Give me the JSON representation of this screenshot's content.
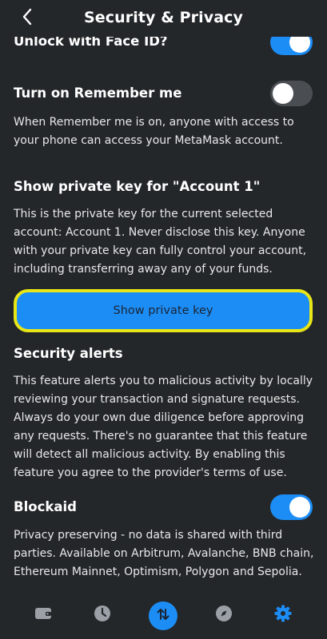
{
  "header": {
    "title": "Security & Privacy"
  },
  "face_id": {
    "label": "Unlock with Face ID?",
    "enabled": true
  },
  "remember_me": {
    "label": "Turn on Remember me",
    "enabled": false,
    "description": "When Remember me is on, anyone with access to your phone can access your MetaMask account."
  },
  "private_key": {
    "title": "Show private key for \"Account 1\"",
    "description": "This is the private key for the current selected account: Account 1. Never disclose this key. Anyone with your private key can fully control your account, including transferring away any of your funds.",
    "button_label": "Show private key"
  },
  "security_alerts": {
    "title": "Security alerts",
    "description": "This feature alerts you to malicious activity by locally reviewing your transaction and signature requests. Always do your own due diligence before approving any requests. There's no guarantee that this feature will detect all malicious activity. By enabling this feature you agree to the provider's terms of use."
  },
  "blockaid": {
    "label": "Blockaid",
    "enabled": true,
    "description": "Privacy preserving - no data is shared with third parties. Available on Arbitrum, Avalanche, BNB chain, Ethereum Mainnet, Optimism, Polygon and Sepolia."
  },
  "bottom_nav": {
    "items": [
      {
        "icon": "wallet-icon",
        "active": false
      },
      {
        "icon": "clock-icon",
        "active": false
      },
      {
        "icon": "swap-arrows-icon",
        "active": false
      },
      {
        "icon": "compass-icon",
        "active": false
      },
      {
        "icon": "gear-icon",
        "active": true
      }
    ]
  },
  "colors": {
    "background": "#24272a",
    "accent": "#1c8df5",
    "highlight_border": "#e8e617",
    "toggle_off": "#4a4e53"
  }
}
